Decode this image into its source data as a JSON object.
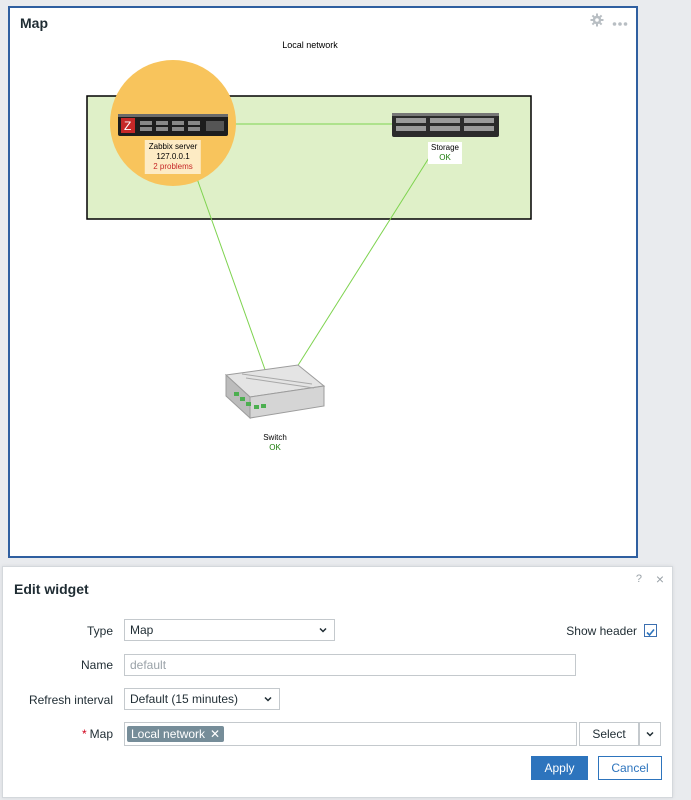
{
  "widget": {
    "title": "Map",
    "map": {
      "title": "Local network",
      "hosts": [
        {
          "name": "Zabbix server",
          "address": "127.0.0.1",
          "status": "2 problems"
        },
        {
          "name": "Storage",
          "status": "OK"
        },
        {
          "name": "Switch",
          "status": "OK"
        }
      ]
    },
    "icons": {
      "settings": "gear-icon",
      "more": "ellipsis-icon"
    }
  },
  "dialog": {
    "title": "Edit widget",
    "help": "?",
    "close": "×",
    "type": {
      "label": "Type",
      "value": "Map"
    },
    "show_header": {
      "label": "Show header",
      "checked": true
    },
    "name": {
      "label": "Name",
      "placeholder": "default",
      "value": ""
    },
    "refresh": {
      "label": "Refresh interval",
      "value": "Default (15 minutes)"
    },
    "map": {
      "label": "Map",
      "required_marker": "*",
      "selected": "Local network",
      "select_label": "Select"
    },
    "buttons": {
      "apply": "Apply",
      "cancel": "Cancel"
    }
  },
  "colors": {
    "accent": "#2d74bd",
    "widget_border": "#2f5fa0",
    "map_group_fill": "#dff0c8",
    "problem_highlight": "#f8c45c",
    "link": "#7ed34f",
    "ok": "#1b7b0a",
    "problem": "#c62828"
  }
}
